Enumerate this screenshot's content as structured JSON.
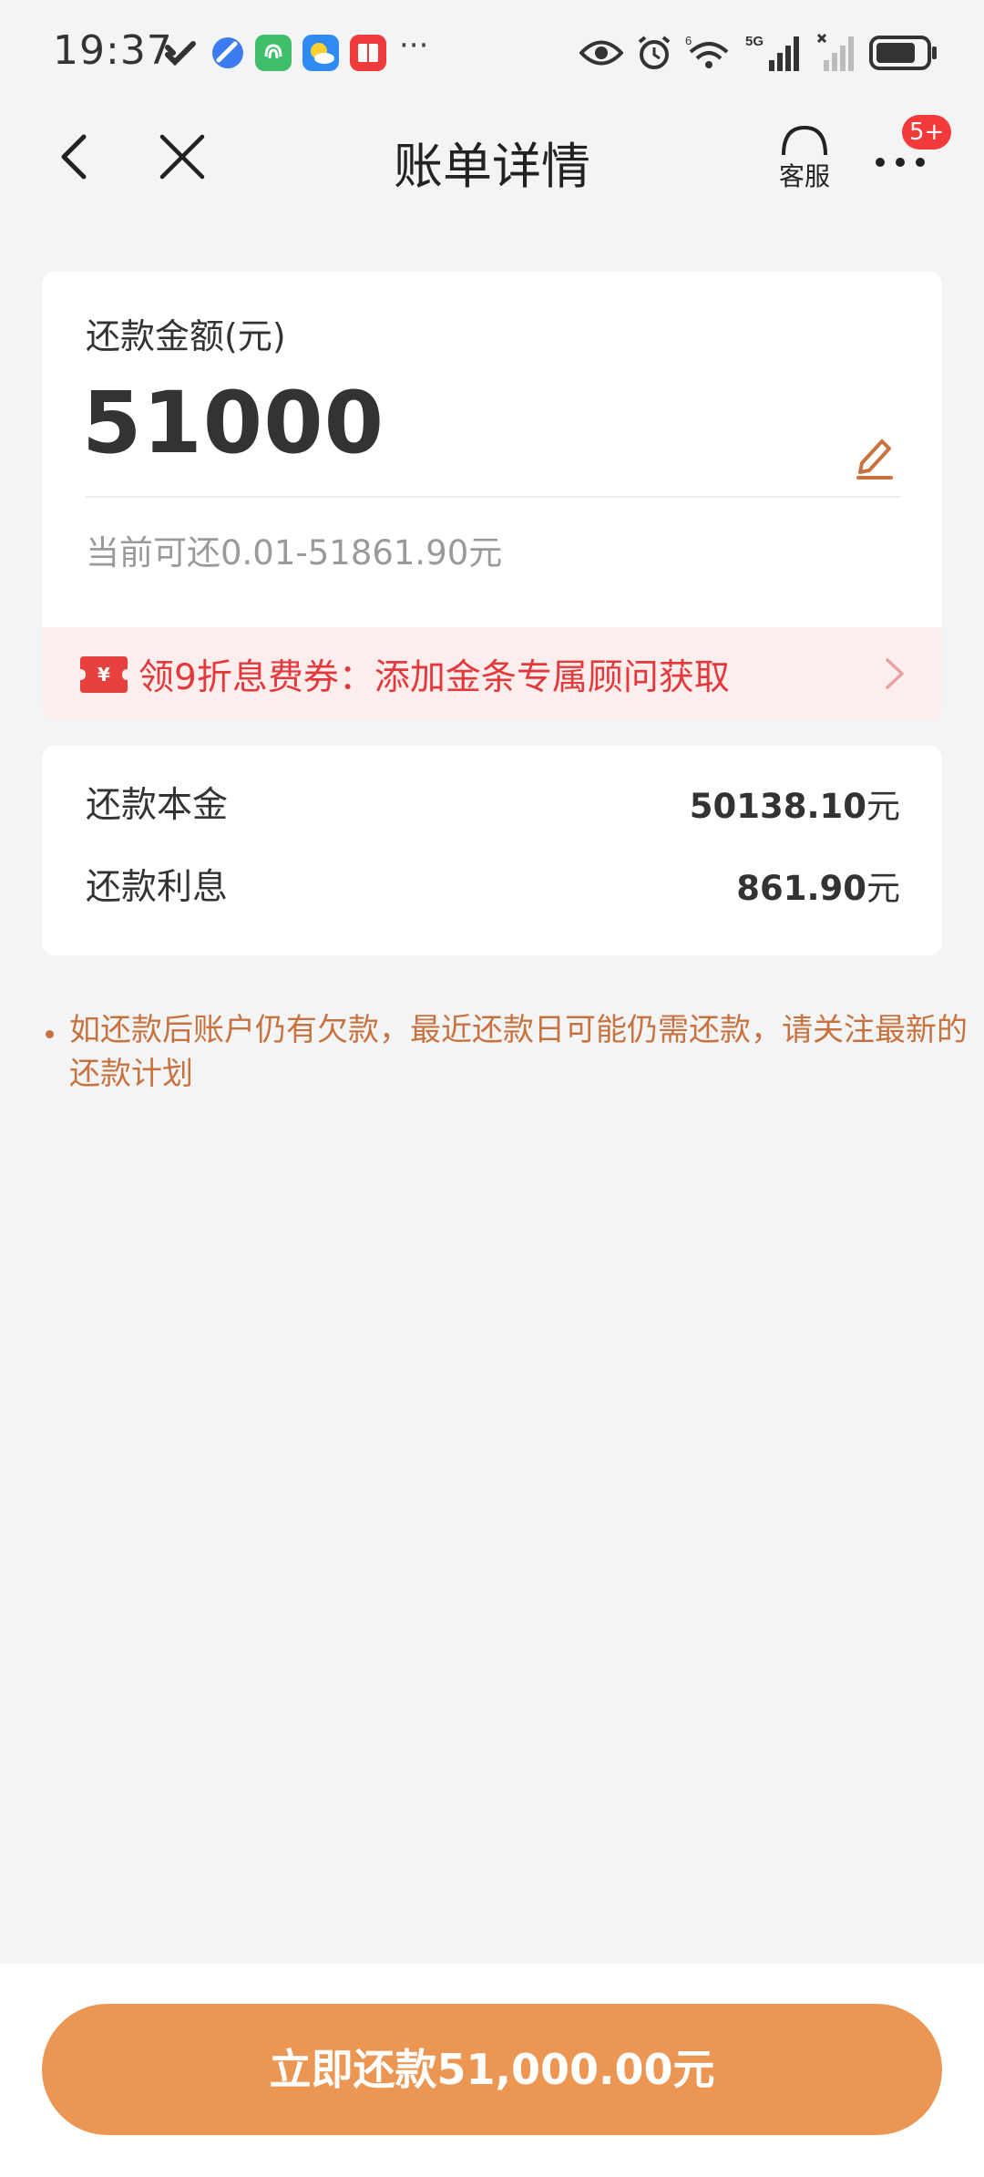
{
  "status_bar": {
    "time": "19:37",
    "more_indicator": "···",
    "network_label": "5G",
    "wifi_badge": "6",
    "app_icons": [
      "health-app-icon",
      "browser-app-icon",
      "fingerprint-app-icon",
      "weather-app-icon",
      "reader-app-icon"
    ],
    "right_icons": [
      "eye-icon",
      "alarm-icon",
      "wifi-icon",
      "signal-icon",
      "no-signal-icon",
      "battery-icon"
    ]
  },
  "nav": {
    "title": "账单详情",
    "service_label": "客服",
    "badge": "5+"
  },
  "amount_card": {
    "label": "还款金额(元)",
    "value": "51000",
    "range_text": "当前可还0.01-51861.90元"
  },
  "promo": {
    "icon_symbol": "¥",
    "text": "领9折息费券：添加金条专属顾问获取"
  },
  "details": {
    "rows": [
      {
        "label": "还款本金",
        "value": "50138.10",
        "unit": "元"
      },
      {
        "label": "还款利息",
        "value": "861.90",
        "unit": "元"
      }
    ]
  },
  "notice": {
    "text": "如还款后账户仍有欠款，最近还款日可能仍需还款，请关注最新的还款计划"
  },
  "pay_button": {
    "label": "立即还款51,000.00元"
  },
  "colors": {
    "accent": "#ec9653",
    "promo_red": "#e4393c",
    "notice_orange": "#c8733f",
    "background": "#f3f4f6"
  }
}
